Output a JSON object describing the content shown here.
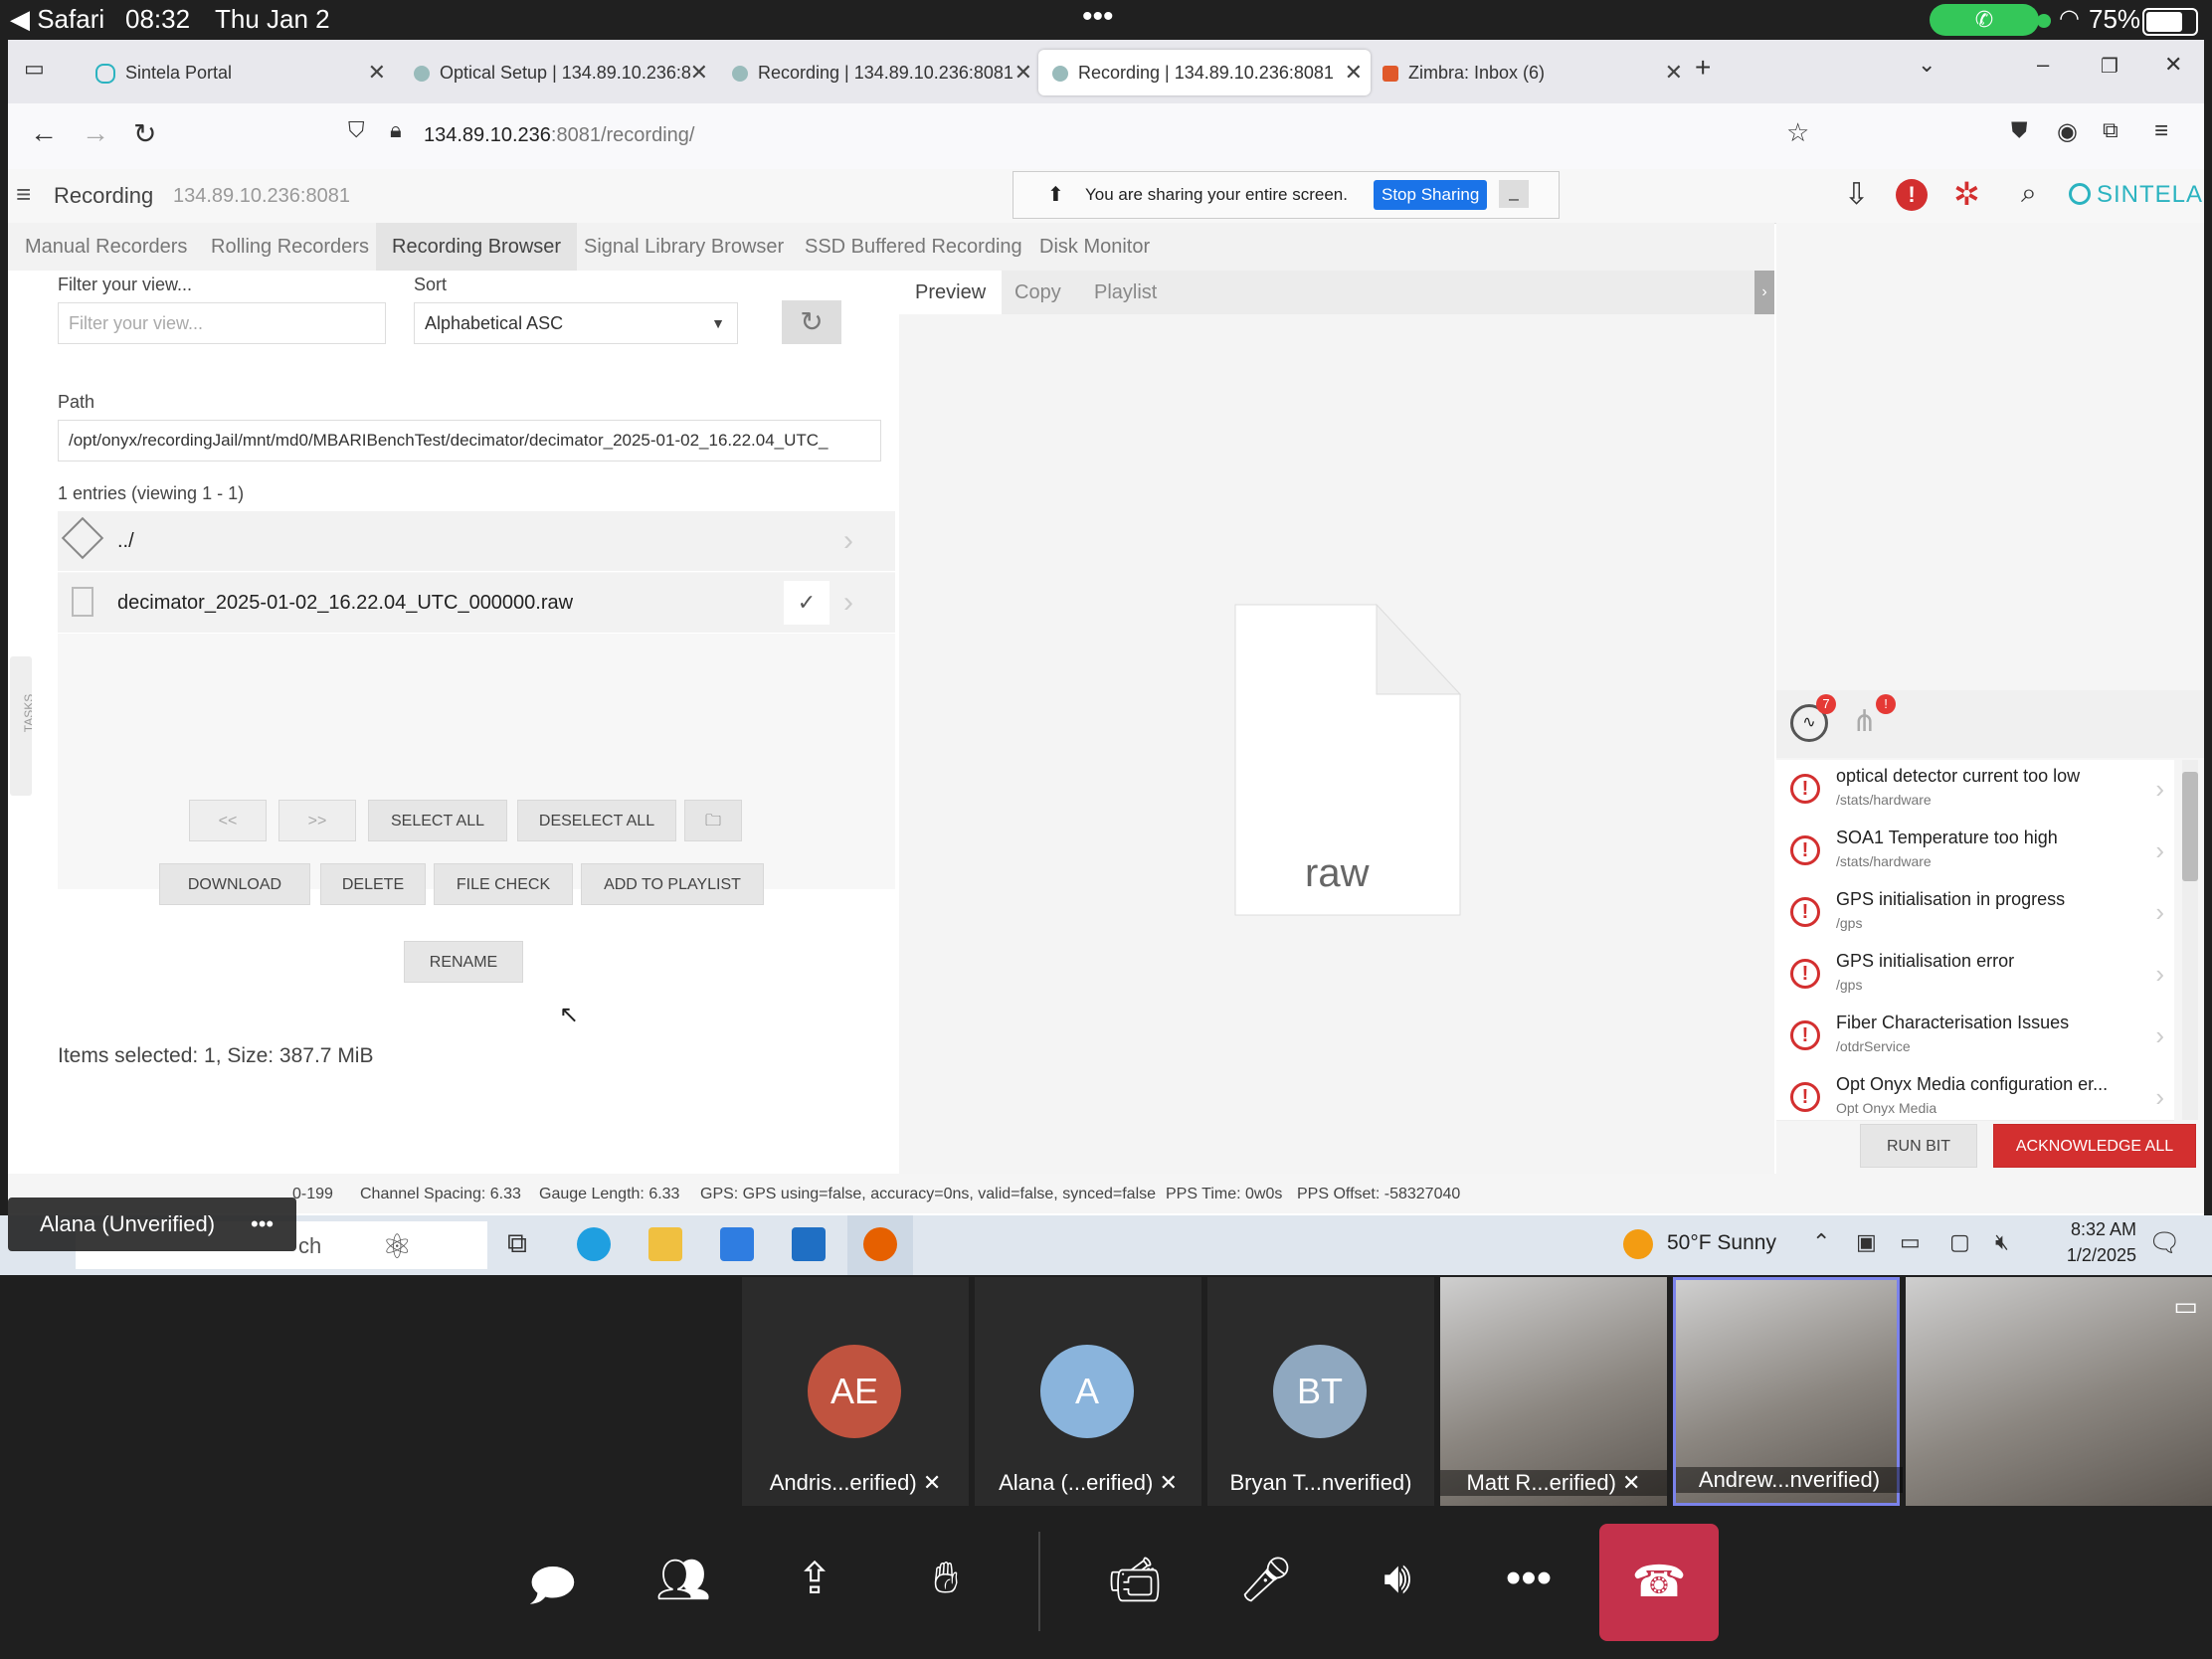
{
  "ipad": {
    "back_app": "◀ Safari",
    "time": "08:32",
    "date": "Thu Jan 2",
    "battery": "75%",
    "dots": "•••"
  },
  "browser": {
    "tabs": [
      {
        "label": "Sintela Portal",
        "icon": "sintela-favicon"
      },
      {
        "label": "Optical Setup | 134.89.10.236:8",
        "icon": "page-favicon"
      },
      {
        "label": "Recording | 134.89.10.236:8081",
        "icon": "page-favicon"
      },
      {
        "label": "Recording | 134.89.10.236:8081",
        "icon": "page-favicon"
      },
      {
        "label": "Zimbra: Inbox (6)",
        "icon": "zimbra-favicon"
      }
    ],
    "url_host": "134.89.10.236",
    "url_rest": ":8081/recording/"
  },
  "app": {
    "title": "Recording",
    "host": "134.89.10.236:8081",
    "share_text": "You are sharing your entire screen.",
    "stop_sharing": "Stop Sharing",
    "brand": "SINTELA",
    "tabs": [
      "Manual Recorders",
      "Rolling Recorders",
      "Recording Browser",
      "Signal Library Browser",
      "SSD Buffered Recording",
      "Disk Monitor"
    ],
    "filter_label": "Filter your view...",
    "filter_placeholder": "Filter your view...",
    "sort_label": "Sort",
    "sort_value": "Alphabetical ASC",
    "path_label": "Path",
    "path_value": "/opt/onyx/recordingJail/mnt/md0/MBARIBenchTest/decimator/decimator_2025-01-02_16.22.04_UTC_",
    "entries_text": "1 entries (viewing 1 - 1)",
    "rows": [
      {
        "name": "../"
      },
      {
        "name": "decimator_2025-01-02_16.22.04_UTC_000000.raw"
      }
    ],
    "buttons": {
      "prev": "<<",
      "next": ">>",
      "select_all": "SELECT ALL",
      "deselect_all": "DESELECT ALL",
      "download": "DOWNLOAD",
      "delete": "DELETE",
      "file_check": "FILE CHECK",
      "add_playlist": "ADD TO PLAYLIST",
      "rename": "RENAME"
    },
    "selection_text": "Items selected: 1, Size: 387.7 MiB",
    "preview_tabs": [
      "Preview",
      "Copy",
      "Playlist"
    ],
    "preview_file_label": "raw",
    "tasks_label": "TASKS",
    "alert_badge_1": "7",
    "alert_badge_2": "!",
    "alerts": [
      {
        "title": "optical detector current too low",
        "sub": "/stats/hardware"
      },
      {
        "title": "SOA1 Temperature too high",
        "sub": "/stats/hardware"
      },
      {
        "title": "GPS initialisation in progress",
        "sub": "/gps"
      },
      {
        "title": "GPS initialisation error",
        "sub": "/gps"
      },
      {
        "title": "Fiber Characterisation Issues",
        "sub": "/otdrService"
      },
      {
        "title": "Opt Onyx Media configuration er...",
        "sub": "Opt Onyx Media"
      }
    ],
    "run_bit": "RUN BIT",
    "ack_all": "ACKNOWLEDGE ALL",
    "footer": {
      "range": "0-199",
      "channel_spacing": "Channel Spacing: 6.33",
      "gauge_length": "Gauge Length: 6.33",
      "gps": "GPS: GPS using=false, accuracy=0ns, valid=false, synced=false",
      "pps_time": "PPS Time: 0w0s",
      "pps_offset": "PPS Offset: -58327040"
    }
  },
  "taskbar": {
    "search_tail": "ch",
    "weather": "50°F Sunny",
    "time": "8:32 AM",
    "date": "1/2/2025"
  },
  "teams": {
    "presenter": "Alana (Unverified)",
    "more": "•••",
    "participants": [
      {
        "initials": "AE",
        "name": "Andris...erified)",
        "color": "#c0533f"
      },
      {
        "initials": "A",
        "name": "Alana (...erified)",
        "color": "#8ab4dc"
      },
      {
        "initials": "BT",
        "name": "Bryan T...nverified)",
        "color": "#8fa8c0"
      },
      {
        "initials": "",
        "name": "Matt R...erified)",
        "color": ""
      },
      {
        "initials": "",
        "name": "Andrew...nverified)",
        "color": ""
      }
    ]
  },
  "colors": {
    "accent": "#1a73e8",
    "danger": "#d32f2f",
    "ack": "#d32f2f",
    "teams_hangup": "#c4314b",
    "brand": "#2bb3c0"
  }
}
